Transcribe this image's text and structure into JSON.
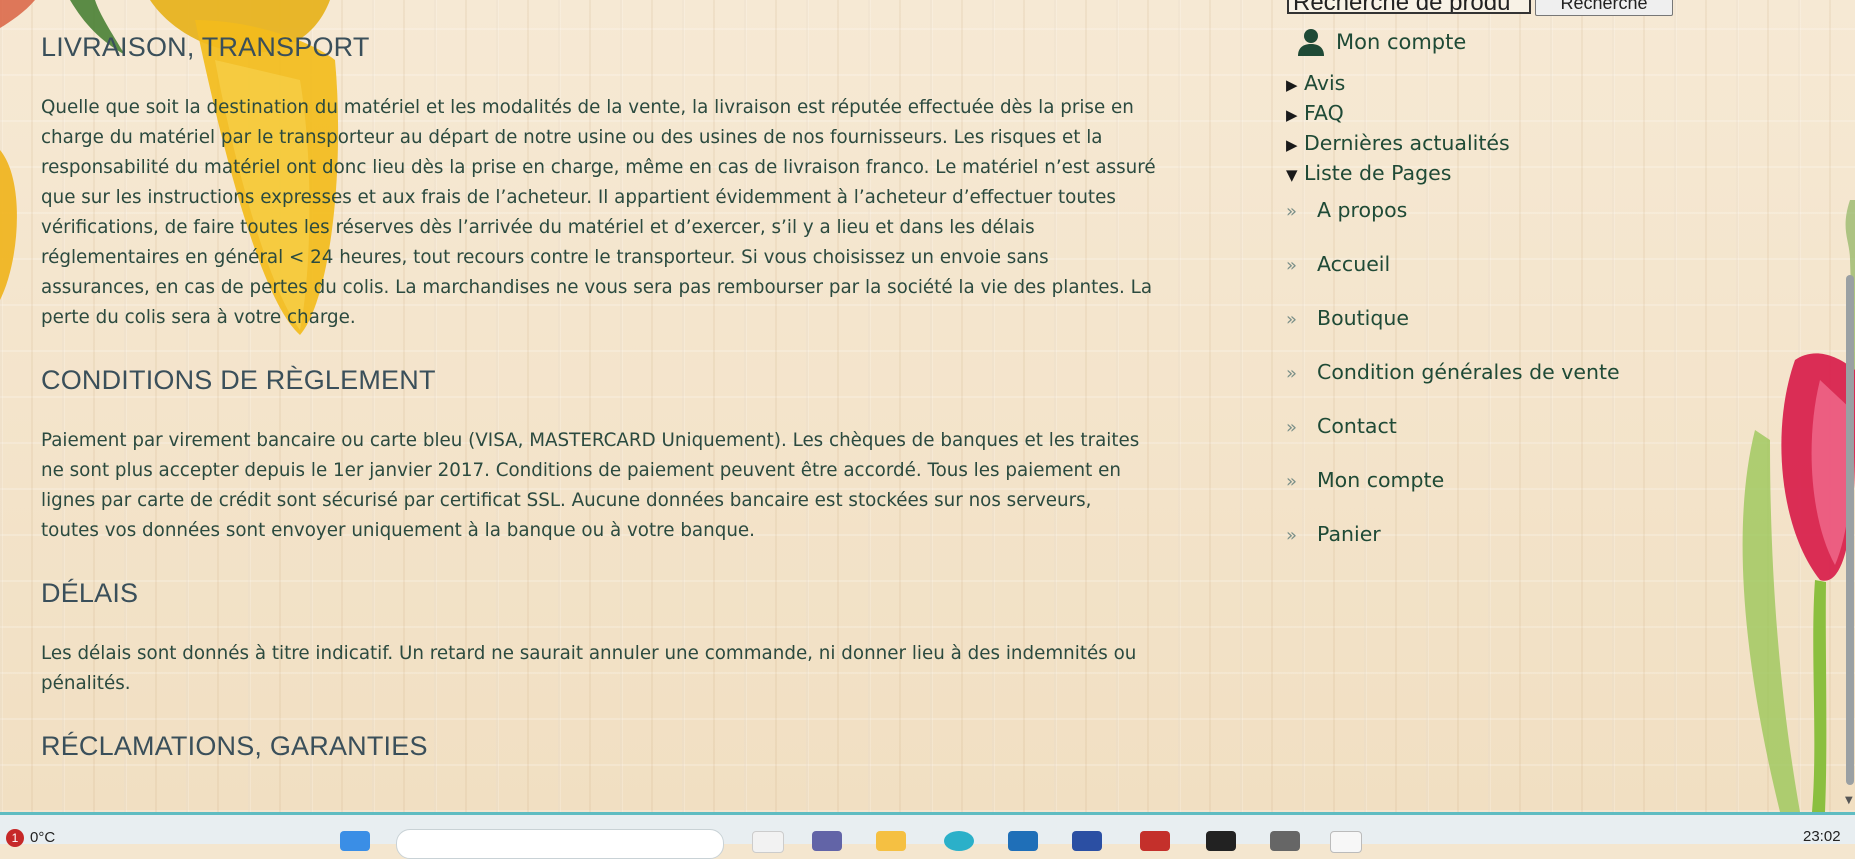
{
  "main": {
    "sections": [
      {
        "heading": "LIVRAISON, TRANSPORT",
        "lines": [
          "Quelle que soit la destination du matériel et les modalités de la vente, la livraison est réputée effectuée dès la prise en",
          "charge du matériel par le transporteur au départ de notre usine ou des usines de nos fournisseurs. Les risques et la",
          "responsabilité du matériel ont donc lieu dès la prise en charge, même en cas de livraison franco. Le matériel n’est assuré",
          "que sur les instructions expresses et aux frais de l’acheteur. Il appartient évidemment à l’acheteur d’effectuer toutes",
          "vérifications, de faire toutes les réserves dès l’arrivée du matériel et d’exercer, s’il y a lieu et dans les délais",
          "réglementaires en général < 24 heures, tout recours contre le transporteur. Si vous choisissez un envoie sans",
          "assurances, en cas de pertes du colis. La marchandises ne vous sera pas rembourser par la société la vie des plantes. La",
          "perte du colis sera à votre charge."
        ]
      },
      {
        "heading": "CONDITIONS DE RÈGLEMENT",
        "lines": [
          "Paiement par virement bancaire ou carte bleu (VISA, MASTERCARD Uniquement). Les chèques de banques et les traites",
          "ne sont plus accepter depuis le 1er janvier 2017. Conditions de paiement peuvent être accordé. Tous les paiement en",
          "lignes par carte de crédit sont sécurisé par certificat SSL. Aucune données bancaire est stockées sur nos serveurs,",
          "toutes vos données sont envoyer uniquement à la banque ou à votre banque."
        ]
      },
      {
        "heading": "DÉLAIS",
        "lines": [
          "Les délais sont donnés à titre indicatif. Un retard ne saurait annuler une commande, ni donner lieu à des indemnités ou",
          "pénalités."
        ]
      },
      {
        "heading": "RÉCLAMATIONS, GARANTIES",
        "lines": []
      }
    ]
  },
  "sidebar": {
    "search_value": "Recherche de produ",
    "search_button": "Recherche",
    "account_label": "Mon compte",
    "disclosures": [
      {
        "label": "Avis",
        "open": false,
        "marker": "▶"
      },
      {
        "label": "FAQ",
        "open": false,
        "marker": "▶"
      },
      {
        "label": "Dernières actualités",
        "open": false,
        "marker": "▶"
      },
      {
        "label": "Liste de Pages",
        "open": true,
        "marker": "▼"
      }
    ],
    "pages": [
      "A propos",
      "Accueil",
      "Boutique",
      "Condition générales de vente",
      "Contact",
      "Mon compte",
      "Panier"
    ],
    "chevron": "»"
  },
  "taskbar": {
    "weather_badge": "1",
    "weather_temp": "0°C",
    "clock": "23:02",
    "colors": {
      "accent": "#5fbcc2",
      "bar": "#e8eef1"
    }
  }
}
